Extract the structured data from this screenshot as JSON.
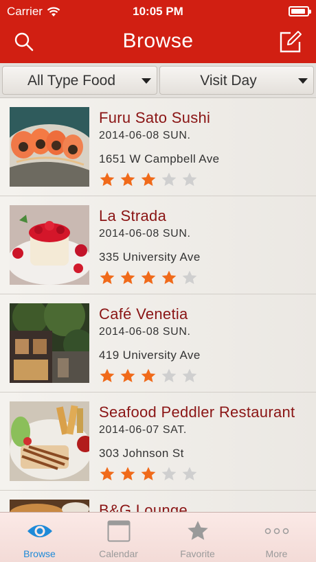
{
  "status_bar": {
    "carrier": "Carrier",
    "time": "10:05 PM",
    "battery_level": 0.9
  },
  "nav": {
    "title": "Browse",
    "search_icon": "search-icon",
    "compose_icon": "compose-icon"
  },
  "filters": {
    "food_type": "All Type Food",
    "visit_day": "Visit Day"
  },
  "restaurants": [
    {
      "name": "Furu Sato Sushi",
      "date": "2014-06-08 SUN.",
      "address": "1651 W Campbell Ave",
      "rating": 3,
      "max_rating": 5
    },
    {
      "name": "La Strada",
      "date": "2014-06-08 SUN.",
      "address": "335 University Ave",
      "rating": 4,
      "max_rating": 5
    },
    {
      "name": "Café Venetia",
      "date": "2014-06-08 SUN.",
      "address": "419 University Ave",
      "rating": 3,
      "max_rating": 5
    },
    {
      "name": "Seafood Peddler Restaurant",
      "date": "2014-06-07 SAT.",
      "address": "303 Johnson St",
      "rating": 3,
      "max_rating": 5
    },
    {
      "name": "B&G Lounge"
    }
  ],
  "tabs": [
    {
      "label": "Browse",
      "icon": "eye-icon",
      "active": true
    },
    {
      "label": "Calendar",
      "icon": "calendar-icon",
      "active": false
    },
    {
      "label": "Favorite",
      "icon": "star-icon",
      "active": false
    },
    {
      "label": "More",
      "icon": "more-icon",
      "active": false
    }
  ],
  "colors": {
    "brand_red": "#d11f12",
    "name_text": "#8a1414",
    "star_filled": "#f06a1a",
    "star_empty": "#cfcfcf",
    "tab_active": "#1e8ad8",
    "tab_inactive": "#9a9a9a"
  }
}
